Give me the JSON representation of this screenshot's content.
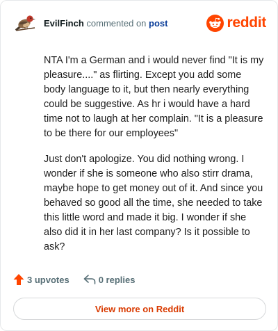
{
  "header": {
    "author": "EvilFinch",
    "action_text": "commented on",
    "target_link": "post",
    "brand": "reddit"
  },
  "comment": {
    "paragraphs": [
      "NTA I'm a German and i would never find \"It is my pleasure....\" as flirting. Except you add some body language to it, but then nearly everything could be suggestive. As hr i would have a hard time not to laugh at her complain. \"It is a pleasure to be there for our employees\"",
      "Just don't apologize. You did nothing wrong. I wonder if she is someone who also stirr drama, maybe hope to get money out of it. And since you behaved so good all the time, she needed to take this little word and made it big. I wonder if she also did it in her last company? Is it possible to ask?"
    ]
  },
  "actions": {
    "upvotes": "3 upvotes",
    "replies": "0 replies"
  },
  "footer": {
    "view_more": "View more on Reddit"
  },
  "icons": {
    "avatar": "finch-bird-avatar",
    "brand": "reddit-snoo-icon",
    "upvote": "upvote-arrow-icon",
    "reply": "reply-arrow-icon"
  },
  "colors": {
    "brand": "#ff4500",
    "link": "#0a3d99",
    "view_more": "#d93a00",
    "upvote": "#ff4500"
  }
}
